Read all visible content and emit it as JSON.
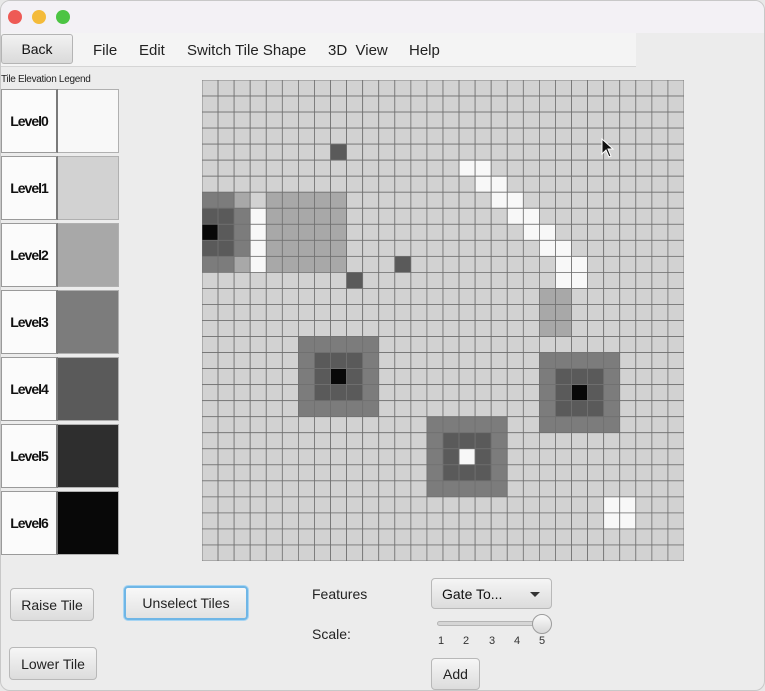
{
  "toolbar": {
    "back_label": "Back",
    "menus": [
      "File",
      "Edit",
      "Switch Tile Shape",
      "3D  View",
      "Help"
    ]
  },
  "legend": {
    "title": "Tile Elevation Legend",
    "levels": [
      {
        "label": "Level0",
        "color": "#f8f8f8"
      },
      {
        "label": "Level1",
        "color": "#d2d2d2"
      },
      {
        "label": "Level2",
        "color": "#a8a8a8"
      },
      {
        "label": "Level3",
        "color": "#7c7c7c"
      },
      {
        "label": "Level4",
        "color": "#5a5a5a"
      },
      {
        "label": "Level5",
        "color": "#2e2e2e"
      },
      {
        "label": "Level6",
        "color": "#080808"
      }
    ]
  },
  "grid": {
    "cols": 30,
    "rows": 30,
    "default_level": 1,
    "tiles": [
      [
        8,
        4,
        4
      ],
      [
        0,
        7,
        3
      ],
      [
        1,
        7,
        3
      ],
      [
        2,
        7,
        2
      ],
      [
        3,
        7,
        1
      ],
      [
        4,
        7,
        2
      ],
      [
        5,
        7,
        2
      ],
      [
        6,
        7,
        2
      ],
      [
        7,
        7,
        2
      ],
      [
        8,
        7,
        2
      ],
      [
        0,
        8,
        4
      ],
      [
        1,
        8,
        4
      ],
      [
        2,
        8,
        3
      ],
      [
        3,
        8,
        0
      ],
      [
        4,
        8,
        2
      ],
      [
        5,
        8,
        2
      ],
      [
        6,
        8,
        2
      ],
      [
        7,
        8,
        2
      ],
      [
        8,
        8,
        2
      ],
      [
        0,
        9,
        6
      ],
      [
        1,
        9,
        4
      ],
      [
        2,
        9,
        3
      ],
      [
        3,
        9,
        0
      ],
      [
        4,
        9,
        2
      ],
      [
        5,
        9,
        2
      ],
      [
        6,
        9,
        2
      ],
      [
        7,
        9,
        2
      ],
      [
        8,
        9,
        2
      ],
      [
        0,
        10,
        4
      ],
      [
        1,
        10,
        4
      ],
      [
        2,
        10,
        3
      ],
      [
        3,
        10,
        0
      ],
      [
        4,
        10,
        2
      ],
      [
        5,
        10,
        2
      ],
      [
        6,
        10,
        2
      ],
      [
        7,
        10,
        2
      ],
      [
        8,
        10,
        2
      ],
      [
        0,
        11,
        3
      ],
      [
        1,
        11,
        3
      ],
      [
        2,
        11,
        2
      ],
      [
        3,
        11,
        0
      ],
      [
        4,
        11,
        2
      ],
      [
        5,
        11,
        2
      ],
      [
        6,
        11,
        2
      ],
      [
        7,
        11,
        2
      ],
      [
        8,
        11,
        2
      ],
      [
        12,
        11,
        4
      ],
      [
        9,
        12,
        4
      ],
      [
        16,
        5,
        0
      ],
      [
        17,
        6,
        0
      ],
      [
        18,
        7,
        0
      ],
      [
        19,
        8,
        0
      ],
      [
        20,
        9,
        0
      ],
      [
        21,
        10,
        0
      ],
      [
        22,
        11,
        0
      ],
      [
        23,
        12,
        0
      ],
      [
        17,
        5,
        0
      ],
      [
        18,
        6,
        0
      ],
      [
        19,
        7,
        0
      ],
      [
        20,
        8,
        0
      ],
      [
        21,
        9,
        0
      ],
      [
        22,
        10,
        0
      ],
      [
        23,
        11,
        0
      ],
      [
        22,
        12,
        0
      ],
      [
        21,
        13,
        2
      ],
      [
        22,
        13,
        2
      ],
      [
        21,
        14,
        2
      ],
      [
        22,
        14,
        2
      ],
      [
        21,
        15,
        2
      ],
      [
        22,
        15,
        2
      ],
      [
        6,
        16,
        3
      ],
      [
        7,
        16,
        3
      ],
      [
        8,
        16,
        3
      ],
      [
        9,
        16,
        3
      ],
      [
        10,
        16,
        3
      ],
      [
        6,
        17,
        3
      ],
      [
        7,
        17,
        4
      ],
      [
        8,
        17,
        4
      ],
      [
        9,
        17,
        4
      ],
      [
        10,
        17,
        3
      ],
      [
        6,
        18,
        3
      ],
      [
        7,
        18,
        4
      ],
      [
        8,
        18,
        6
      ],
      [
        9,
        18,
        4
      ],
      [
        10,
        18,
        3
      ],
      [
        6,
        19,
        3
      ],
      [
        7,
        19,
        4
      ],
      [
        8,
        19,
        4
      ],
      [
        9,
        19,
        4
      ],
      [
        10,
        19,
        3
      ],
      [
        6,
        20,
        3
      ],
      [
        7,
        20,
        3
      ],
      [
        8,
        20,
        3
      ],
      [
        9,
        20,
        3
      ],
      [
        10,
        20,
        3
      ],
      [
        21,
        17,
        3
      ],
      [
        22,
        17,
        3
      ],
      [
        23,
        17,
        3
      ],
      [
        24,
        17,
        3
      ],
      [
        25,
        17,
        3
      ],
      [
        21,
        18,
        3
      ],
      [
        22,
        18,
        4
      ],
      [
        23,
        18,
        4
      ],
      [
        24,
        18,
        4
      ],
      [
        25,
        18,
        3
      ],
      [
        21,
        19,
        3
      ],
      [
        22,
        19,
        4
      ],
      [
        23,
        19,
        6
      ],
      [
        24,
        19,
        4
      ],
      [
        25,
        19,
        3
      ],
      [
        21,
        20,
        3
      ],
      [
        22,
        20,
        4
      ],
      [
        23,
        20,
        4
      ],
      [
        24,
        20,
        4
      ],
      [
        25,
        20,
        3
      ],
      [
        21,
        21,
        3
      ],
      [
        22,
        21,
        3
      ],
      [
        23,
        21,
        3
      ],
      [
        24,
        21,
        3
      ],
      [
        25,
        21,
        3
      ],
      [
        14,
        21,
        3
      ],
      [
        15,
        21,
        3
      ],
      [
        16,
        21,
        3
      ],
      [
        17,
        21,
        3
      ],
      [
        18,
        21,
        3
      ],
      [
        14,
        22,
        3
      ],
      [
        15,
        22,
        4
      ],
      [
        16,
        22,
        4
      ],
      [
        17,
        22,
        4
      ],
      [
        18,
        22,
        3
      ],
      [
        14,
        23,
        3
      ],
      [
        15,
        23,
        4
      ],
      [
        16,
        23,
        0
      ],
      [
        17,
        23,
        4
      ],
      [
        18,
        23,
        3
      ],
      [
        14,
        24,
        3
      ],
      [
        15,
        24,
        4
      ],
      [
        16,
        24,
        4
      ],
      [
        17,
        24,
        4
      ],
      [
        18,
        24,
        3
      ],
      [
        14,
        25,
        3
      ],
      [
        15,
        25,
        3
      ],
      [
        16,
        25,
        3
      ],
      [
        17,
        25,
        3
      ],
      [
        18,
        25,
        3
      ],
      [
        25,
        26,
        0
      ],
      [
        26,
        26,
        0
      ],
      [
        25,
        27,
        0
      ],
      [
        26,
        27,
        0
      ]
    ]
  },
  "controls": {
    "raise_label": "Raise Tile",
    "lower_label": "Lower Tile",
    "unselect_label": "Unselect Tiles",
    "features_label": "Features",
    "features_value": "Gate To...",
    "scale_label": "Scale:",
    "scale_ticks": [
      "1",
      "2",
      "3",
      "4",
      "5"
    ],
    "scale_value": 5,
    "scale_min": 1,
    "scale_max": 5,
    "add_label": "Add"
  }
}
